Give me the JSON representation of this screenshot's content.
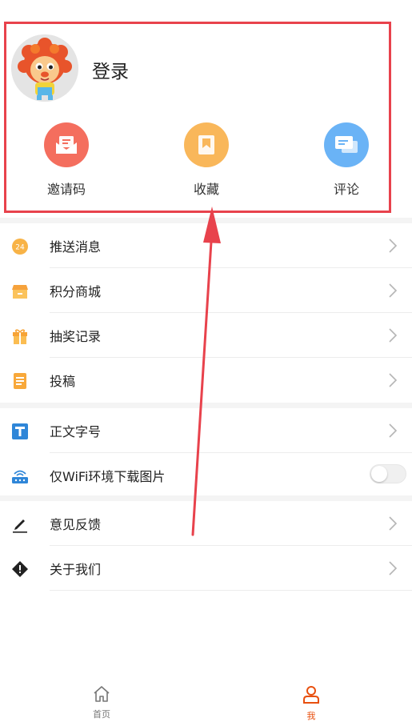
{
  "profile": {
    "login_label": "登录",
    "quick_actions": [
      {
        "label": "邀请码",
        "icon": "invite-envelope-icon",
        "color": "#f46e5e"
      },
      {
        "label": "收藏",
        "icon": "bookmark-icon",
        "color": "#f9b75a"
      },
      {
        "label": "评论",
        "icon": "comment-bubble-icon",
        "color": "#6ab3f6"
      }
    ]
  },
  "menu": {
    "group1": [
      {
        "label": "推送消息",
        "icon": "push-24-icon"
      },
      {
        "label": "积分商城",
        "icon": "points-store-icon"
      },
      {
        "label": "抽奖记录",
        "icon": "gift-icon"
      },
      {
        "label": "投稿",
        "icon": "contribute-doc-icon"
      }
    ],
    "group2": [
      {
        "label": "正文字号",
        "icon": "font-size-icon"
      },
      {
        "label": "仅WiFi环境下载图片",
        "icon": "wifi-router-icon"
      }
    ],
    "group3": [
      {
        "label": "意见反馈",
        "icon": "pencil-icon"
      },
      {
        "label": "关于我们",
        "icon": "info-diamond-icon"
      }
    ]
  },
  "tabbar": {
    "home_label": "首页",
    "me_label": "我"
  },
  "colors": {
    "accent": "#e8500f",
    "highlight": "#e8424c",
    "annotation_arrow": "#e8424c"
  }
}
